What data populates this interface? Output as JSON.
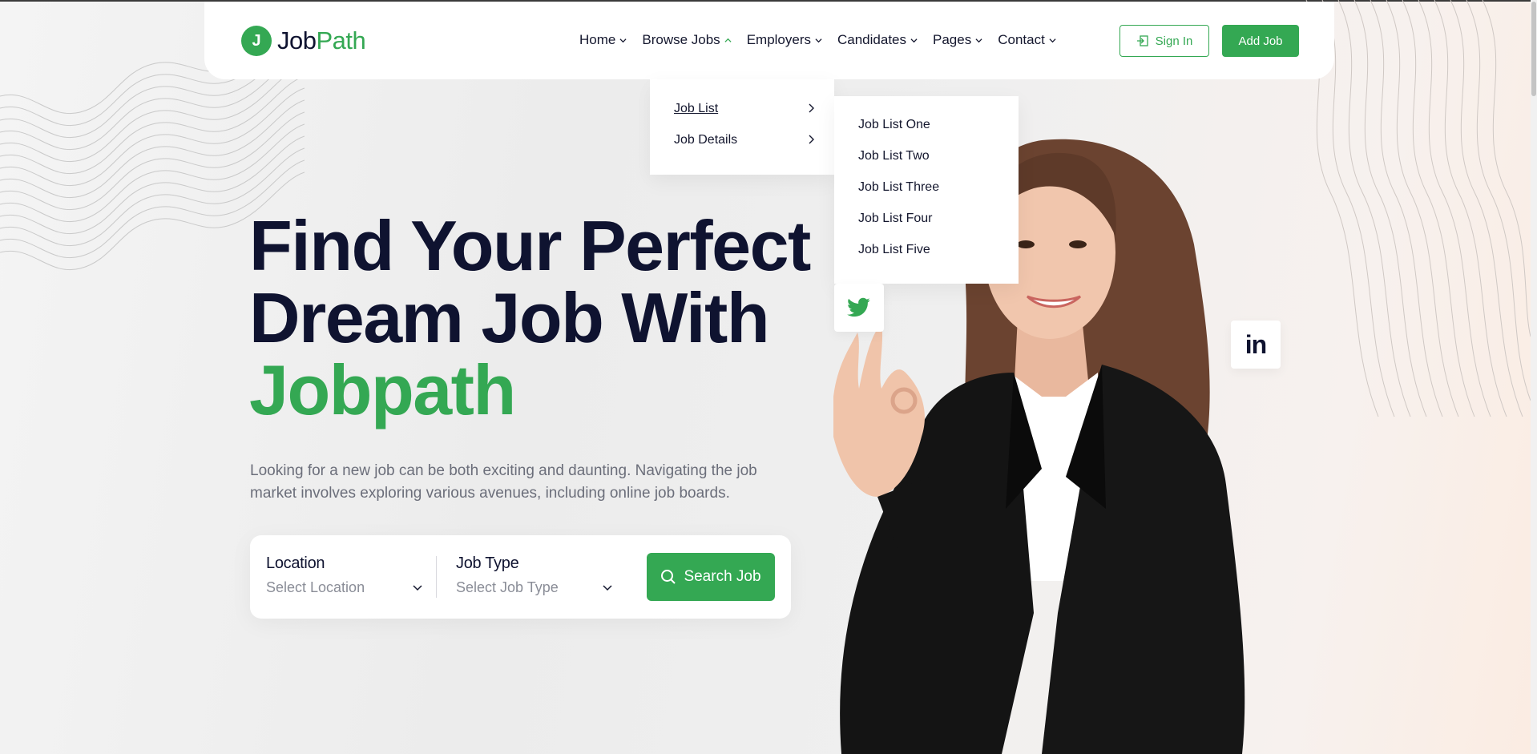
{
  "brand": {
    "name_part1": "Job",
    "name_part2": "Path",
    "mark_letter": "J",
    "accent_color": "#34a853"
  },
  "nav": {
    "items": [
      {
        "label": "Home"
      },
      {
        "label": "Browse Jobs"
      },
      {
        "label": "Employers"
      },
      {
        "label": "Candidates"
      },
      {
        "label": "Pages"
      },
      {
        "label": "Contact"
      }
    ],
    "signin_label": "Sign In",
    "addjob_label": "Add Job"
  },
  "browse_jobs_menu": {
    "items": [
      {
        "label": "Job List"
      },
      {
        "label": "Job Details"
      }
    ]
  },
  "job_list_submenu": {
    "items": [
      {
        "label": "Job List One"
      },
      {
        "label": "Job List Two"
      },
      {
        "label": "Job List Three"
      },
      {
        "label": "Job List Four"
      },
      {
        "label": "Job List Five"
      }
    ]
  },
  "hero": {
    "title_line1": "Find Your Perfect",
    "title_line2": "Dream Job With",
    "title_accent": "Jobpath",
    "description": "Looking for a new job can be both exciting and daunting. Navigating the job market involves exploring various avenues, including online job boards."
  },
  "search": {
    "location_label": "Location",
    "location_value": "Select Location",
    "jobtype_label": "Job Type",
    "jobtype_value": "Select Job Type",
    "button_label": "Search Job"
  },
  "social": {
    "linkedin_text": "in"
  }
}
